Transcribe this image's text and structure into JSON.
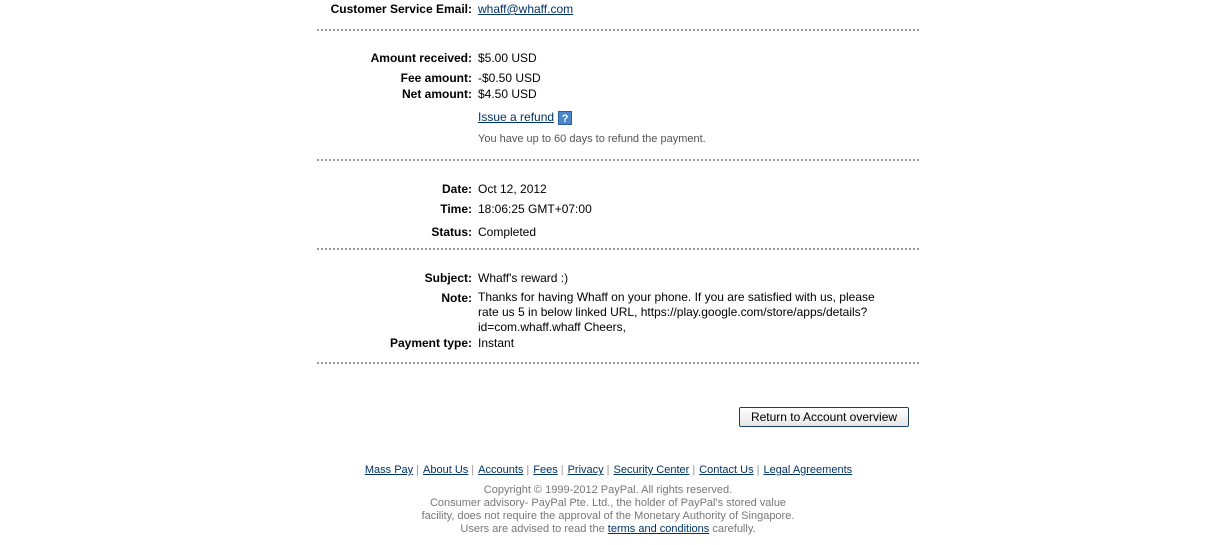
{
  "merchant": {
    "cs_email_label": "Customer Service Email:",
    "cs_email_value": "whaff@whaff.com"
  },
  "amounts": {
    "received_label": "Amount received:",
    "received_value": "$5.00 USD",
    "fee_label": "Fee amount:",
    "fee_value": "-$0.50 USD",
    "net_label": "Net amount:",
    "net_value": "$4.50 USD",
    "refund_link": "Issue a refund",
    "help_icon": "?",
    "refund_hint": "You have up to 60 days to refund the payment."
  },
  "timing": {
    "date_label": "Date:",
    "date_value": "Oct 12, 2012",
    "time_label": "Time:",
    "time_value": "18:06:25 GMT+07:00",
    "status_label": "Status:",
    "status_value": "Completed"
  },
  "message": {
    "subject_label": "Subject:",
    "subject_value": "Whaff's reward :)",
    "note_label": "Note:",
    "note_value": "Thanks for having Whaff on your phone. If you are satisfied with us, please rate us 5 in below linked URL, https://play.google.com/store/apps/details?id=com.whaff.whaff Cheers,",
    "payment_type_label": "Payment type:",
    "payment_type_value": "Instant"
  },
  "actions": {
    "return_button": "Return to Account overview"
  },
  "footer": {
    "links": [
      "Mass Pay",
      "About Us",
      "Accounts",
      "Fees",
      "Privacy",
      "Security Center",
      "Contact Us",
      "Legal Agreements"
    ],
    "copyright_line": "Copyright © 1999-2012 PayPal. All rights reserved.",
    "advisory_line1": "Consumer advisory- PayPal Pte. Ltd., the holder of PayPal's stored value",
    "advisory_line2": "facility, does not require the approval of the Monetary Authority of Singapore.",
    "advisory_line3_pre": "Users are advised to read the",
    "terms_link": "terms and conditions",
    "advisory_line3_post": "carefully."
  },
  "colors": {
    "link": "#003366",
    "divider": "#9a9a9a",
    "muted_text": "#777777",
    "help_icon_bg": "#4a86c8"
  }
}
